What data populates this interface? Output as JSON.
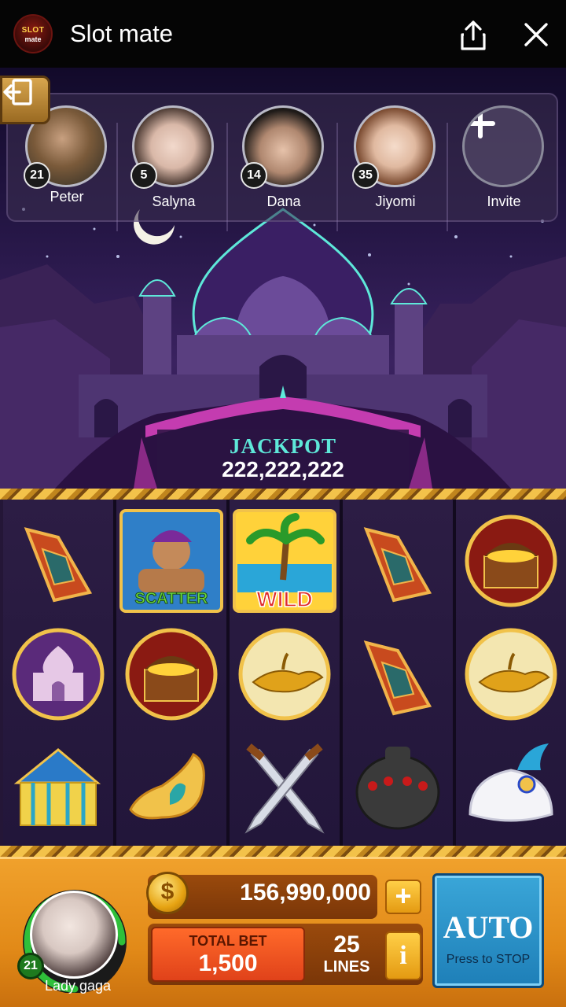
{
  "app": {
    "title": "Slot mate",
    "logo_line1": "SLOT",
    "logo_line2": "mate"
  },
  "friends": [
    {
      "name": "Peter",
      "level": "21"
    },
    {
      "name": "Salyna",
      "level": "5"
    },
    {
      "name": "Dana",
      "level": "14"
    },
    {
      "name": "Jiyomi",
      "level": "35"
    }
  ],
  "invite": {
    "label": "Invite"
  },
  "jackpot": {
    "label": "JACKPOT",
    "value": "222,222,222"
  },
  "symbols": {
    "scatter": "SCATTER",
    "wild": "WILD"
  },
  "player": {
    "name": "Lady gaga",
    "level": "21",
    "level_progress": 0.75
  },
  "balance": {
    "currency_symbol": "$",
    "coins": "156,990,000",
    "add_label": "+"
  },
  "bet": {
    "total_label": "TOTAL BET",
    "total_value": "1,500",
    "lines_value": "25",
    "lines_label": "LINES",
    "info_label": "i"
  },
  "auto": {
    "label": "AUTO",
    "sub_label": "Press to STOP"
  },
  "colors": {
    "jackpot": "#5ee8d9",
    "bar": "#e28a18",
    "auto": "#1e7fb8",
    "level_ring": "#2fbf3a"
  }
}
